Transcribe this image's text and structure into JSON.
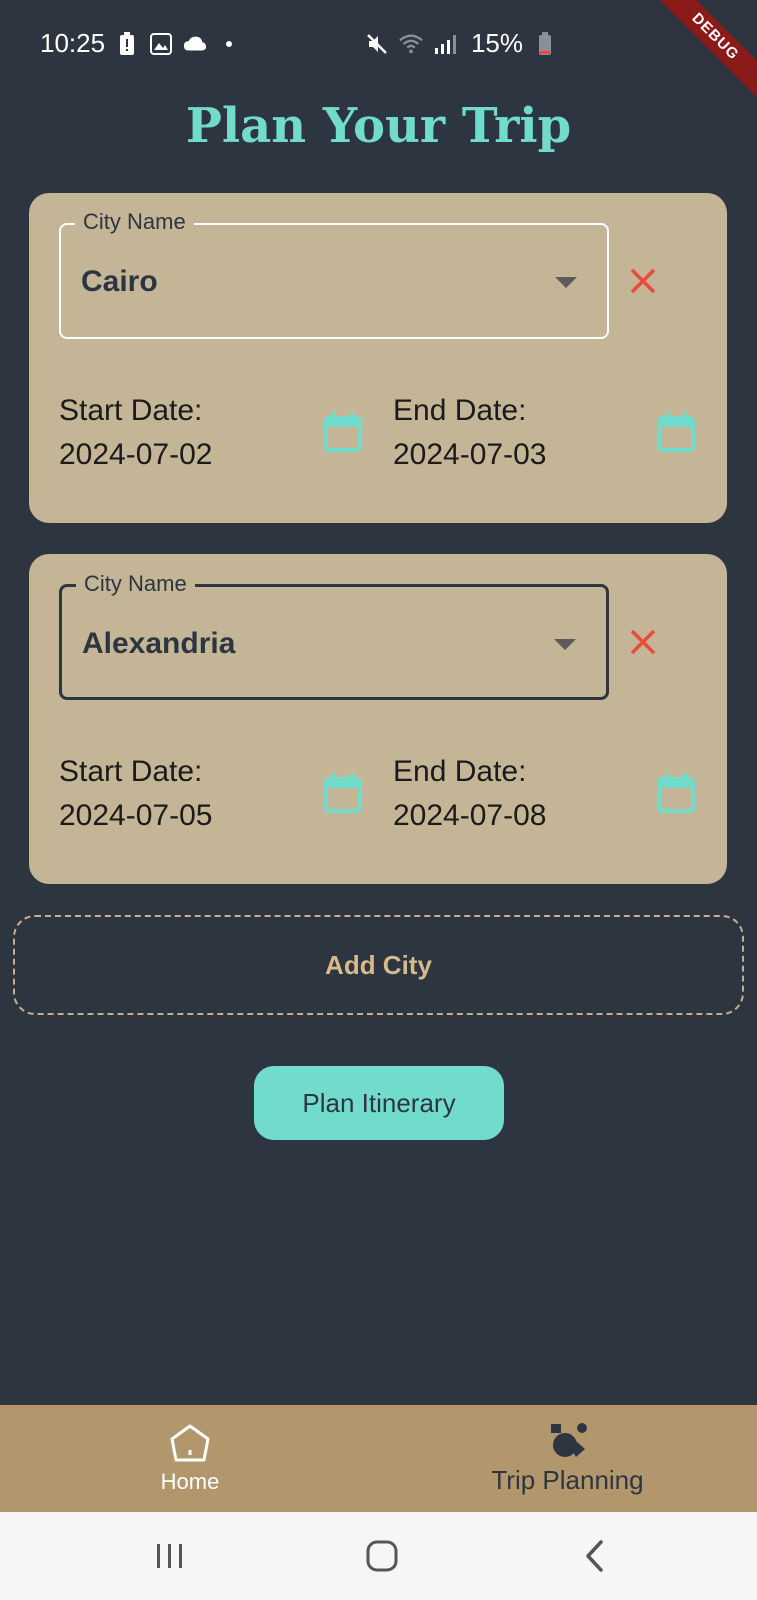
{
  "status_bar": {
    "time": "10:25",
    "battery": "15%",
    "icons_left": [
      "battery-alert-icon",
      "gallery-icon",
      "cloud-icon",
      "dot-icon"
    ],
    "icons_right": [
      "mute-icon",
      "wifi-icon",
      "signal-icon",
      "battery-icon"
    ]
  },
  "debug_label": "DEBUG",
  "page_title": "Plan Your Trip",
  "cities": [
    {
      "field_label": "City Name",
      "city": "Cairo",
      "start_label": "Start Date:",
      "start_date": "2024-07-02",
      "end_label": "End Date:",
      "end_date": "2024-07-03"
    },
    {
      "field_label": "City Name",
      "city": "Alexandria",
      "start_label": "Start Date:",
      "start_date": "2024-07-05",
      "end_label": "End Date:",
      "end_date": "2024-07-08"
    }
  ],
  "add_city_label": "Add City",
  "plan_button_label": "Plan Itinerary",
  "bottom_nav": {
    "items": [
      {
        "label": "Home",
        "icon": "home-icon",
        "active": true
      },
      {
        "label": "Trip Planning",
        "icon": "trip-planning-icon",
        "active": false
      }
    ]
  },
  "colors": {
    "background": "#2d3640",
    "accent": "#72dccc",
    "card": "#c4b596",
    "nav_bar": "#b3976c",
    "remove": "#e74c3c",
    "add_city": "#d7b98c"
  }
}
